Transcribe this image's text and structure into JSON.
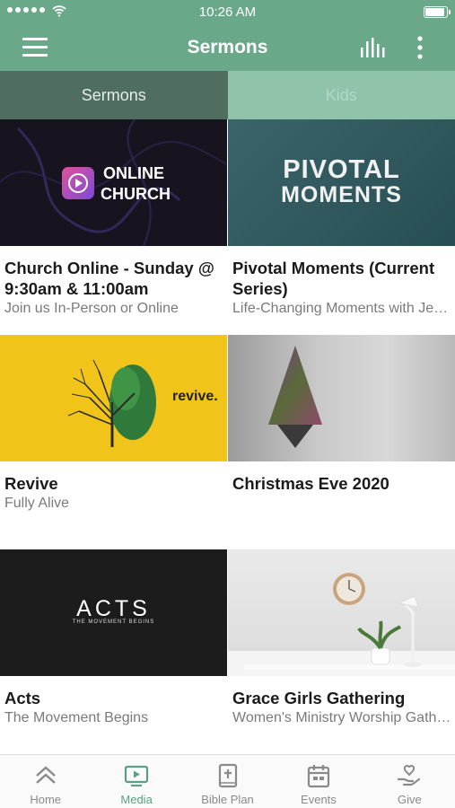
{
  "status_bar": {
    "time": "10:26 AM"
  },
  "app_bar": {
    "title": "Sermons"
  },
  "tabs": [
    {
      "label": "Sermons",
      "active": true
    },
    {
      "label": "Kids",
      "active": false
    }
  ],
  "cards": [
    {
      "title": "Church Online - Sunday @ 9:30am & 11:00am",
      "subtitle": "Join us In-Person or Online",
      "thumb_text": [
        "ONLINE",
        "CHURCH"
      ]
    },
    {
      "title": "Pivotal Moments (Current Series)",
      "subtitle": "Life-Changing Moments with Jesus",
      "thumb_text": [
        "PIVOTAL",
        "MOMENTS"
      ]
    },
    {
      "title": "Revive",
      "subtitle": "Fully Alive",
      "thumb_text": [
        "revive."
      ]
    },
    {
      "title": "Christmas Eve 2020",
      "subtitle": "",
      "thumb_text": []
    },
    {
      "title": "Acts",
      "subtitle": "The Movement Begins",
      "thumb_text": [
        "ACTS",
        "THE MOVEMENT BEGINS"
      ]
    },
    {
      "title": "Grace Girls Gathering",
      "subtitle": "Women's Ministry Worship Gathering",
      "thumb_text": []
    }
  ],
  "bottom_nav": [
    {
      "label": "Home",
      "icon": "home-chevrons-icon",
      "active": false
    },
    {
      "label": "Media",
      "icon": "media-play-icon",
      "active": true
    },
    {
      "label": "Bible Plan",
      "icon": "bible-icon",
      "active": false
    },
    {
      "label": "Events",
      "icon": "calendar-icon",
      "active": false
    },
    {
      "label": "Give",
      "icon": "give-hand-heart-icon",
      "active": false
    }
  ],
  "colors": {
    "brand": "#6aa88a",
    "tab_active_bg": "#4f6e5f",
    "tab_inactive_bg": "#8fc3aa",
    "nav_active": "#5aa084"
  }
}
